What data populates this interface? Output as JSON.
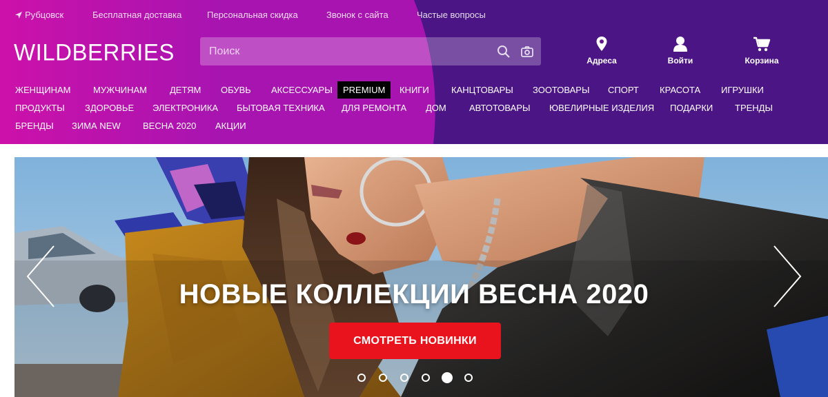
{
  "topbar": {
    "location": "Рубцовск",
    "links": [
      "Бесплатная доставка",
      "Персональная скидка",
      "Звонок с сайта",
      "Частые вопросы"
    ]
  },
  "logo": "WILDBERRIES",
  "search": {
    "placeholder": "Поиск"
  },
  "header_buttons": {
    "addresses": "Адреса",
    "login": "Войти",
    "cart": "Корзина"
  },
  "menu": {
    "row1": [
      "Женщинам",
      "Мужчинам",
      "Детям",
      "Обувь",
      "Аксессуары",
      "PREMIUM",
      "Книги",
      "Канцтовары",
      "Зоотовары",
      "Спорт",
      "Красота",
      "Игрушки"
    ],
    "row2": [
      "Продукты",
      "Здоровье",
      "Электроника",
      "Бытовая техника",
      "Для ремонта",
      "Дом",
      "Автотовары",
      "Ювелирные изделия",
      "Подарки",
      "Тренды"
    ],
    "row3": [
      "Бренды",
      "Зима NEW",
      "Весна 2020",
      "Акции"
    ]
  },
  "banner": {
    "title": "НОВЫЕ КОЛЛЕКЦИИ ВЕСНА 2020",
    "button": "СМОТРЕТЬ НОВИНКИ",
    "slides_total": 6,
    "active_slide": 5
  },
  "colors": {
    "header_left": "#cb11ab",
    "header_right": "#481173",
    "accent_button": "#e8131c"
  }
}
